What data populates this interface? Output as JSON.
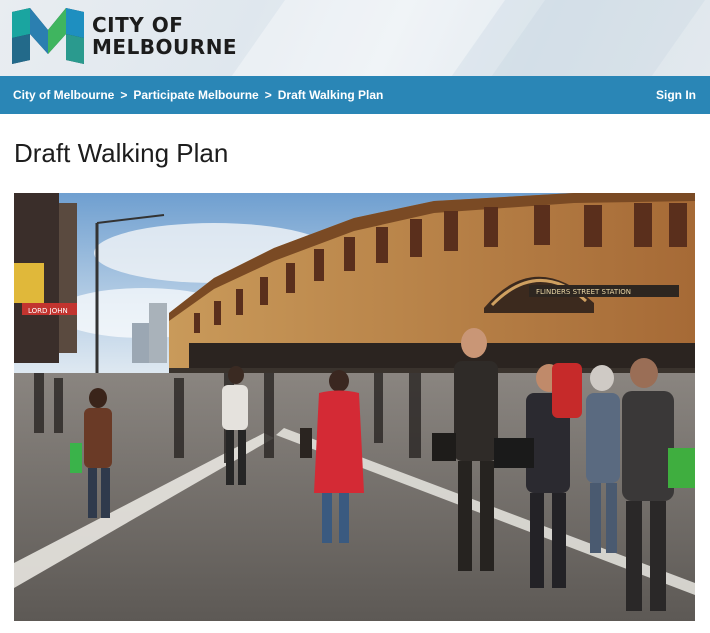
{
  "header": {
    "logo_line1": "CITY OF",
    "logo_line2": "MELBOURNE"
  },
  "nav": {
    "breadcrumb": [
      {
        "label": "City of Melbourne"
      },
      {
        "label": "Participate Melbourne"
      },
      {
        "label": "Draft Walking Plan"
      }
    ],
    "separator": ">",
    "signin_label": "Sign In",
    "bar_color": "#2a86b6"
  },
  "main": {
    "title": "Draft Walking Plan"
  },
  "hero": {
    "sign_station": "FLINDERS STREET STATION",
    "sign_shop": "LORD JOHN"
  },
  "colors": {
    "logo_teal": "#1aa5a0",
    "logo_dark": "#1c3a4e",
    "logo_green": "#3fb55f"
  }
}
